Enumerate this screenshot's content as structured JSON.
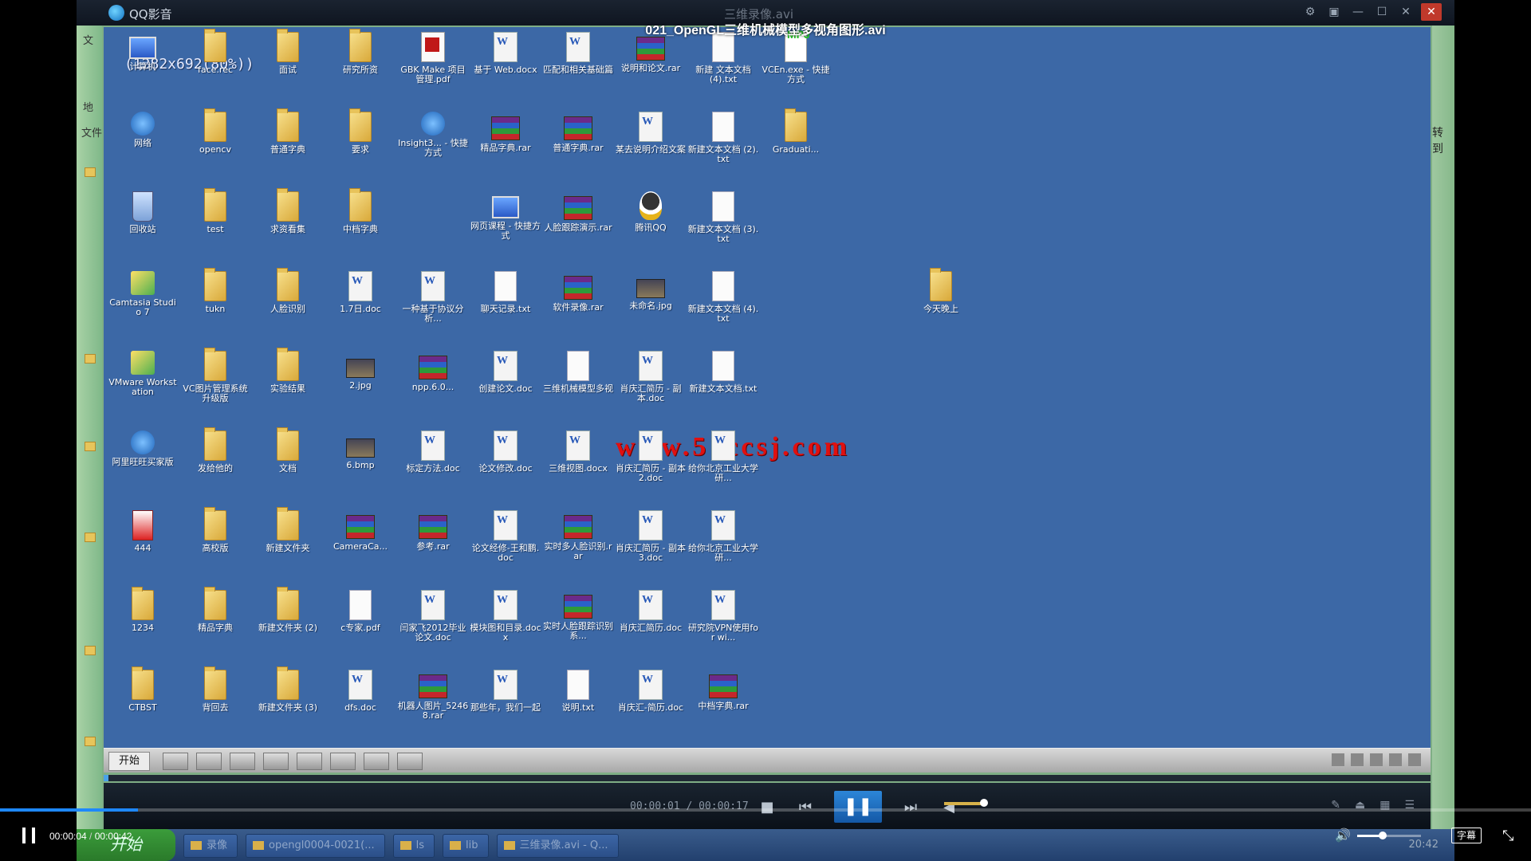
{
  "video_title": "021_OpenGL三维机械模型多视角图形.avi",
  "qq_player": {
    "app_name": "QQ影音",
    "file_name": "三维录像.avi",
    "size_label": "(1282x692(80%))",
    "left_strip_chars": [
      "文",
      "地",
      "文件"
    ],
    "right_strip_text": "转到",
    "elapsed": "00:00:01 / 00:00:17",
    "buttons": {
      "stop": "■",
      "prev": "⏮",
      "play": "❚❚",
      "next": "⏭",
      "vol": "◀"
    }
  },
  "watermark": "www.51ccsj.com",
  "desktop_icons": [
    {
      "label": "计算机",
      "type": "computer",
      "col": 0,
      "row": 0
    },
    {
      "label": "face.rec",
      "type": "folder",
      "col": 1,
      "row": 0
    },
    {
      "label": "面试",
      "type": "folder",
      "col": 2,
      "row": 0
    },
    {
      "label": "研究所资",
      "type": "folder",
      "col": 3,
      "row": 0
    },
    {
      "label": "GBK Make 项目管理.pdf",
      "type": "pdf",
      "col": 4,
      "row": 0
    },
    {
      "label": "基于 Web.docx",
      "type": "doc",
      "col": 5,
      "row": 0
    },
    {
      "label": "匹配和相关基础篇",
      "type": "doc",
      "col": 6,
      "row": 0
    },
    {
      "label": "说明和论文.rar",
      "type": "rar",
      "col": 7,
      "row": 0
    },
    {
      "label": "新建 文本文档 (4).txt",
      "type": "txt",
      "col": 8,
      "row": 0
    },
    {
      "label": "VCEn.exe - 快捷方式",
      "type": "mpj",
      "col": 9,
      "row": 0
    },
    {
      "label": "网络",
      "type": "net",
      "col": 0,
      "row": 1
    },
    {
      "label": "opencv",
      "type": "folder",
      "col": 1,
      "row": 1
    },
    {
      "label": "普通字典",
      "type": "folder",
      "col": 2,
      "row": 1
    },
    {
      "label": "要求",
      "type": "folder",
      "col": 3,
      "row": 1
    },
    {
      "label": "Insight3... - 快捷方式",
      "type": "net",
      "col": 4,
      "row": 1
    },
    {
      "label": "精品字典.rar",
      "type": "rar",
      "col": 5,
      "row": 1
    },
    {
      "label": "普通字典.rar",
      "type": "rar",
      "col": 6,
      "row": 1
    },
    {
      "label": "某去说明介绍文案",
      "type": "doc",
      "col": 7,
      "row": 1
    },
    {
      "label": "新建文本文档 (2).txt",
      "type": "txt",
      "col": 8,
      "row": 1
    },
    {
      "label": "Graduati...",
      "type": "folder",
      "col": 9,
      "row": 1
    },
    {
      "label": "回收站",
      "type": "recycle",
      "col": 0,
      "row": 2
    },
    {
      "label": "test",
      "type": "folder",
      "col": 1,
      "row": 2
    },
    {
      "label": "求资看集",
      "type": "folder",
      "col": 2,
      "row": 2
    },
    {
      "label": "中档字典",
      "type": "folder",
      "col": 3,
      "row": 2
    },
    {
      "label": "网页课程 - 快捷方式",
      "type": "computer",
      "col": 5,
      "row": 2
    },
    {
      "label": "人脸跟踪演示.rar",
      "type": "rar",
      "col": 6,
      "row": 2
    },
    {
      "label": "腾讯QQ",
      "type": "qq",
      "col": 7,
      "row": 2
    },
    {
      "label": "新建文本文档 (3).txt",
      "type": "txt",
      "col": 8,
      "row": 2
    },
    {
      "label": "Camtasia Studio 7",
      "type": "app",
      "col": 0,
      "row": 3
    },
    {
      "label": "tukn",
      "type": "folder",
      "col": 1,
      "row": 3
    },
    {
      "label": "人脸识别",
      "type": "folder",
      "col": 2,
      "row": 3
    },
    {
      "label": "1.7日.doc",
      "type": "doc",
      "col": 3,
      "row": 3
    },
    {
      "label": "一种基于协议分析...",
      "type": "doc",
      "col": 4,
      "row": 3
    },
    {
      "label": "聊天记录.txt",
      "type": "txt",
      "col": 5,
      "row": 3
    },
    {
      "label": "软件录像.rar",
      "type": "rar",
      "col": 6,
      "row": 3
    },
    {
      "label": "未命名.jpg",
      "type": "img",
      "col": 7,
      "row": 3
    },
    {
      "label": "新建文本文档 (4).txt",
      "type": "txt",
      "col": 8,
      "row": 3
    },
    {
      "label": "今天晚上",
      "type": "folder",
      "col": 11,
      "row": 3
    },
    {
      "label": "VMware Workstation",
      "type": "app",
      "col": 0,
      "row": 4
    },
    {
      "label": "VC图片管理系统升级版",
      "type": "folder",
      "col": 1,
      "row": 4
    },
    {
      "label": "实验结果",
      "type": "folder",
      "col": 2,
      "row": 4
    },
    {
      "label": "2.jpg",
      "type": "img",
      "col": 3,
      "row": 4
    },
    {
      "label": "npp.6.0...",
      "type": "rar",
      "col": 4,
      "row": 4
    },
    {
      "label": "创建论文.doc",
      "type": "doc",
      "col": 5,
      "row": 4
    },
    {
      "label": "三维机械模型多视",
      "type": "txt",
      "col": 6,
      "row": 4
    },
    {
      "label": "肖庆汇简历 - 副本.doc",
      "type": "doc",
      "col": 7,
      "row": 4
    },
    {
      "label": "新建文本文档.txt",
      "type": "txt",
      "col": 8,
      "row": 4
    },
    {
      "label": "阿里旺旺买家版",
      "type": "net",
      "col": 0,
      "row": 5
    },
    {
      "label": "发给他的",
      "type": "folder",
      "col": 1,
      "row": 5
    },
    {
      "label": "文档",
      "type": "folder",
      "col": 2,
      "row": 5
    },
    {
      "label": "6.bmp",
      "type": "img",
      "col": 3,
      "row": 5
    },
    {
      "label": "标定方法.doc",
      "type": "doc",
      "col": 4,
      "row": 5
    },
    {
      "label": "论文修改.doc",
      "type": "doc",
      "col": 5,
      "row": 5
    },
    {
      "label": "三维视图.docx",
      "type": "doc",
      "col": 6,
      "row": 5
    },
    {
      "label": "肖庆汇简历 - 副本2.doc",
      "type": "doc",
      "col": 7,
      "row": 5
    },
    {
      "label": "给你北京工业大学研...",
      "type": "doc",
      "col": 8,
      "row": 5
    },
    {
      "label": "444",
      "type": "red",
      "col": 0,
      "row": 6
    },
    {
      "label": "高校版",
      "type": "folder",
      "col": 1,
      "row": 6
    },
    {
      "label": "新建文件夹",
      "type": "folder",
      "col": 2,
      "row": 6
    },
    {
      "label": "CameraCa...",
      "type": "rar",
      "col": 3,
      "row": 6
    },
    {
      "label": "参考.rar",
      "type": "rar",
      "col": 4,
      "row": 6
    },
    {
      "label": "论文经修-王和鹏.doc",
      "type": "doc",
      "col": 5,
      "row": 6
    },
    {
      "label": "实时多人脸识别.rar",
      "type": "rar",
      "col": 6,
      "row": 6
    },
    {
      "label": "肖庆汇简历 - 副本3.doc",
      "type": "doc",
      "col": 7,
      "row": 6
    },
    {
      "label": "给你北京工业大学研...",
      "type": "doc",
      "col": 8,
      "row": 6
    },
    {
      "label": "1234",
      "type": "folder",
      "col": 0,
      "row": 7
    },
    {
      "label": "精品字典",
      "type": "folder",
      "col": 1,
      "row": 7
    },
    {
      "label": "新建文件夹 (2)",
      "type": "folder",
      "col": 2,
      "row": 7
    },
    {
      "label": "c专家.pdf",
      "type": "txt",
      "col": 3,
      "row": 7
    },
    {
      "label": "闫家飞2012毕业论文.doc",
      "type": "doc",
      "col": 4,
      "row": 7
    },
    {
      "label": "模块图和目录.docx",
      "type": "doc",
      "col": 5,
      "row": 7
    },
    {
      "label": "实时人脸跟踪识别系...",
      "type": "rar",
      "col": 6,
      "row": 7
    },
    {
      "label": "肖庆汇简历.doc",
      "type": "doc",
      "col": 7,
      "row": 7
    },
    {
      "label": "研究院VPN使用for wi...",
      "type": "doc",
      "col": 8,
      "row": 7
    },
    {
      "label": "CTBST",
      "type": "folder",
      "col": 0,
      "row": 8
    },
    {
      "label": "背回去",
      "type": "folder",
      "col": 1,
      "row": 8
    },
    {
      "label": "新建文件夹 (3)",
      "type": "folder",
      "col": 2,
      "row": 8
    },
    {
      "label": "dfs.doc",
      "type": "doc",
      "col": 3,
      "row": 8
    },
    {
      "label": "机器人图片_52468.rar",
      "type": "rar",
      "col": 4,
      "row": 8
    },
    {
      "label": "那些年，我们一起",
      "type": "doc",
      "col": 5,
      "row": 8
    },
    {
      "label": "说明.txt",
      "type": "txt",
      "col": 6,
      "row": 8
    },
    {
      "label": "肖庆汇-简历.doc",
      "type": "doc",
      "col": 7,
      "row": 8
    },
    {
      "label": "中档字典.rar",
      "type": "rar",
      "col": 8,
      "row": 8
    }
  ],
  "inner_taskbar": {
    "start_label": "开始"
  },
  "host_taskbar": {
    "start_label": "开始",
    "tasks": [
      "录像",
      "opengl0004-0021(...",
      "ls",
      "lib",
      "三维录像.avi - Q..."
    ],
    "clock": "20:42"
  },
  "web_player": {
    "current_time": "00:00:04",
    "separator": " / ",
    "duration": "00:00:42",
    "progress_fraction": 0.09,
    "volume_fraction": 0.4,
    "subtitle_label": "字幕",
    "accent": "#1e88ff"
  }
}
